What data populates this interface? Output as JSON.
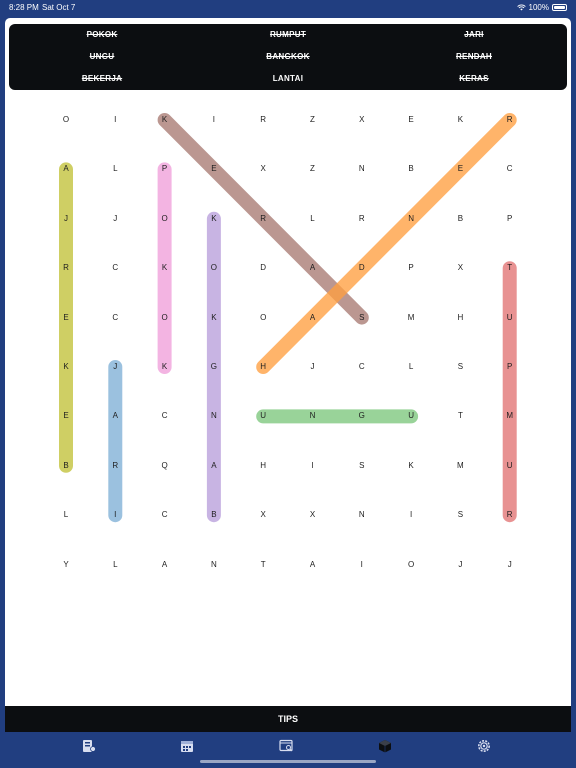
{
  "status_bar": {
    "time": "8:28 PM",
    "date": "Sat Oct 7",
    "battery": "100%"
  },
  "word_list": [
    {
      "text": "POKOK",
      "found": true
    },
    {
      "text": "RUMPUT",
      "found": true
    },
    {
      "text": "JARI",
      "found": true
    },
    {
      "text": "UNGU",
      "found": true
    },
    {
      "text": "BANGKOK",
      "found": true
    },
    {
      "text": "RENDAH",
      "found": true
    },
    {
      "text": "BEKERJA",
      "found": true
    },
    {
      "text": "LANTAI",
      "found": false
    },
    {
      "text": "KERAS",
      "found": true
    }
  ],
  "grid": [
    [
      "O",
      "I",
      "K",
      "I",
      "R",
      "Z",
      "X",
      "E",
      "K",
      "R"
    ],
    [
      "A",
      "L",
      "P",
      "E",
      "X",
      "Z",
      "N",
      "B",
      "E",
      "C"
    ],
    [
      "J",
      "J",
      "O",
      "K",
      "R",
      "L",
      "R",
      "N",
      "B",
      "P"
    ],
    [
      "R",
      "C",
      "K",
      "O",
      "D",
      "A",
      "D",
      "P",
      "X",
      "T"
    ],
    [
      "E",
      "C",
      "O",
      "K",
      "O",
      "A",
      "S",
      "M",
      "H",
      "U"
    ],
    [
      "K",
      "J",
      "K",
      "G",
      "H",
      "J",
      "C",
      "L",
      "S",
      "P"
    ],
    [
      "E",
      "A",
      "C",
      "N",
      "U",
      "N",
      "G",
      "U",
      "T",
      "M"
    ],
    [
      "B",
      "R",
      "Q",
      "A",
      "H",
      "I",
      "S",
      "K",
      "M",
      "U"
    ],
    [
      "L",
      "I",
      "C",
      "B",
      "X",
      "X",
      "N",
      "I",
      "S",
      "R"
    ],
    [
      "Y",
      "L",
      "A",
      "N",
      "T",
      "A",
      "I",
      "O",
      "J",
      "J"
    ]
  ],
  "highlights": [
    {
      "word": "KERAS",
      "from": [
        0,
        2
      ],
      "to": [
        4,
        6
      ],
      "color": "#a87a72"
    },
    {
      "word": "RENDAH",
      "from": [
        0,
        9
      ],
      "to": [
        5,
        4
      ],
      "color": "#ff9f40"
    },
    {
      "word": "BEKERJA",
      "from": [
        1,
        0
      ],
      "to": [
        7,
        0
      ],
      "color": "#c2c238"
    },
    {
      "word": "POKOK",
      "from": [
        1,
        2
      ],
      "to": [
        5,
        2
      ],
      "color": "#ef9fda"
    },
    {
      "word": "BANGKOK",
      "from": [
        2,
        3
      ],
      "to": [
        8,
        3
      ],
      "color": "#b89fdb"
    },
    {
      "word": "RUMPUT",
      "from": [
        3,
        9
      ],
      "to": [
        8,
        9
      ],
      "color": "#e27373"
    },
    {
      "word": "JARI",
      "from": [
        5,
        1
      ],
      "to": [
        8,
        1
      ],
      "color": "#7fb0d6"
    },
    {
      "word": "UNGU",
      "from": [
        6,
        4
      ],
      "to": [
        6,
        7
      ],
      "color": "#7cc77c"
    }
  ],
  "tips_label": "TIPS",
  "nav_icons": [
    "puzzle-list-icon",
    "calendar-icon",
    "browser-search-icon",
    "cube-icon",
    "gear-icon"
  ]
}
